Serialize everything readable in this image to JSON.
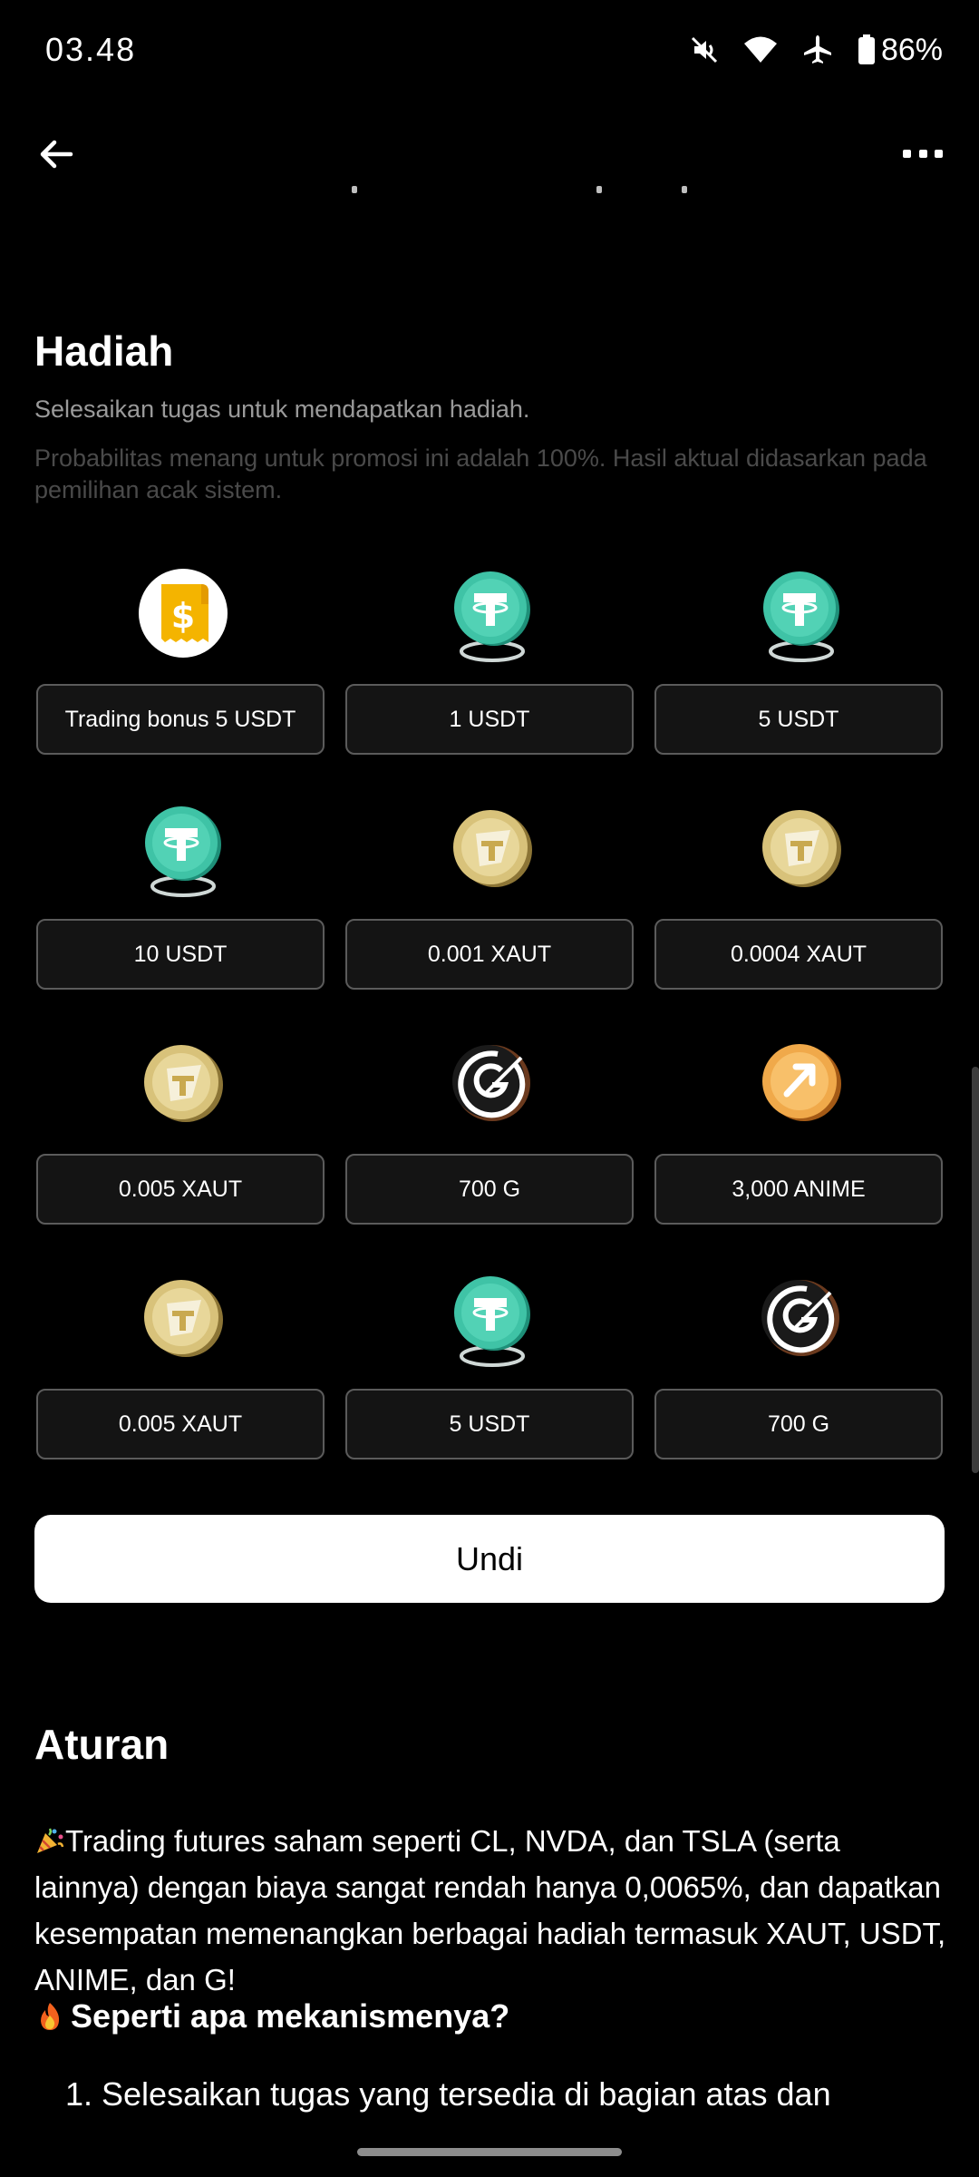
{
  "status_bar": {
    "time": "03.48",
    "battery": "86%",
    "icons": [
      "mute-icon",
      "wifi-icon",
      "airplane-icon",
      "battery-icon"
    ]
  },
  "app_bar": {
    "back_icon": "arrow-left-icon",
    "more_icon": "more-horizontal-icon"
  },
  "rewards": {
    "title": "Hadiah",
    "subtitle": "Selesaikan tugas untuk mendapatkan hadiah.",
    "note": "Probabilitas menang untuk promosi ini adalah 100%. Hasil aktual didasarkan pada pemilihan acak sistem.",
    "items": [
      {
        "label": "Trading bonus 5 USDT",
        "icon": "voucher-dollar-icon"
      },
      {
        "label": "1 USDT",
        "icon": "usdt-coin-icon"
      },
      {
        "label": "5 USDT",
        "icon": "usdt-coin-icon"
      },
      {
        "label": "10 USDT",
        "icon": "usdt-coin-icon"
      },
      {
        "label": "0.001 XAUT",
        "icon": "xaut-coin-icon"
      },
      {
        "label": "0.0004 XAUT",
        "icon": "xaut-coin-icon"
      },
      {
        "label": "0.005 XAUT",
        "icon": "xaut-coin-icon"
      },
      {
        "label": "700 G",
        "icon": "g-coin-icon"
      },
      {
        "label": "3,000 ANIME",
        "icon": "anime-coin-icon"
      },
      {
        "label": "0.005 XAUT",
        "icon": "xaut-coin-icon"
      },
      {
        "label": "5 USDT",
        "icon": "usdt-coin-icon"
      },
      {
        "label": "700 G",
        "icon": "g-coin-icon"
      }
    ],
    "draw_button": "Undi"
  },
  "rules": {
    "title": "Aturan",
    "paragraph": "Trading futures saham seperti CL, NVDA, dan TSLA (serta lainnya) dengan biaya sangat rendah hanya 0,0065%, dan dapatkan kesempatan memenangkan berbagai hadiah termasuk XAUT, USDT, ANIME, dan G!",
    "heading": "Seperti apa mekanismenya?",
    "list_item": "1. Selesaikan tugas yang tersedia di bagian atas dan"
  },
  "colors": {
    "background": "#000000",
    "pill_border": "#5b5b5b",
    "subtitle": "#9a9a9a",
    "note": "#4a4a4a",
    "usdt": "#3fc3a6",
    "xaut": "#d8c27a",
    "anime": "#f0a94a"
  }
}
